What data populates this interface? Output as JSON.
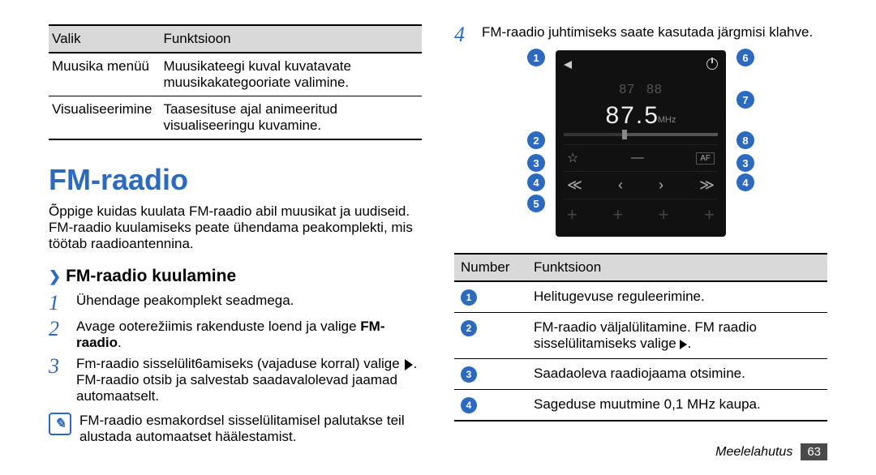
{
  "left": {
    "options_table": {
      "header": [
        "Valik",
        "Funktsioon"
      ],
      "rows": [
        {
          "option": "Muusika menüü",
          "func": "Muusikateegi kuval kuvatavate muusikakategooriate valimine."
        },
        {
          "option": "Visualiseerimine",
          "func": "Taasesituse ajal animeeritud visualiseeringu kuvamine."
        }
      ]
    },
    "heading": "FM-raadio",
    "intro": "Õppige kuidas kuulata FM-raadio abil muusikat ja uudiseid. FM-raadio kuulamiseks peate ühendama peakomplekti, mis töötab raadioantennina.",
    "subheading": "FM-raadio kuulamine",
    "steps": [
      "Ühendage peakomplekt seadmega.",
      "Avage ooterežiimis rakenduste loend ja valige FM-raadio.",
      "Fm-raadio sisselülit6amiseks (vajaduse korral) valige"
    ],
    "step3_extra": "FM-raadio otsib ja salvestab saadavalolevad jaamad automaatselt.",
    "step2_bold": "FM-raadio",
    "note": "FM-raadio esmakordsel sisselülitamisel palutakse teil alustada automaatset häälestamist."
  },
  "right": {
    "step4": "FM-raadio juhtimiseks saate kasutada järgmisi klahve.",
    "radio": {
      "freq_left": "87",
      "freq_mid": "88",
      "freq_main": "87.5",
      "unit": "MHz",
      "af": "AF"
    },
    "callouts_left": [
      "1",
      "2",
      "3",
      "4",
      "5"
    ],
    "callouts_right": [
      "6",
      "7",
      "8",
      "3",
      "4"
    ],
    "num_table": {
      "header": [
        "Number",
        "Funktsioon"
      ],
      "rows": [
        {
          "n": "1",
          "func": "Helitugevuse reguleerimine."
        },
        {
          "n": "2",
          "func": "FM-raadio väljalülitamine. FM raadio sisselülitamiseks valige"
        },
        {
          "n": "3",
          "func": "Saadaoleva raadiojaama otsimine."
        },
        {
          "n": "4",
          "func": "Sageduse muutmine 0,1 MHz kaupa."
        }
      ]
    }
  },
  "footer": {
    "section": "Meelelahutus",
    "page": "63"
  }
}
